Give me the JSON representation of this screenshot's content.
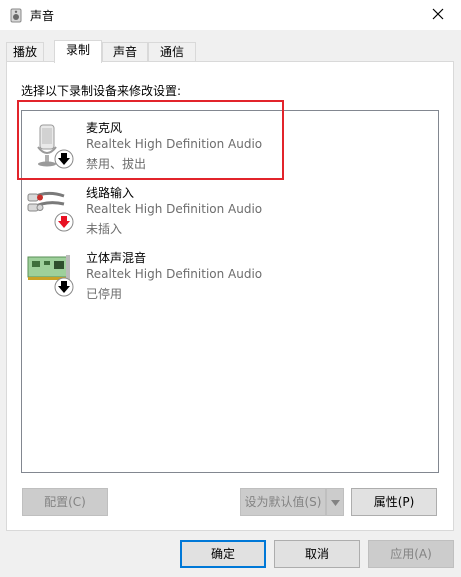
{
  "window": {
    "title": "声音",
    "icon": "speaker-icon",
    "close_icon": "close-icon"
  },
  "tabs": [
    {
      "label": "播放",
      "active": false
    },
    {
      "label": "录制",
      "active": true
    },
    {
      "label": "声音",
      "active": false
    },
    {
      "label": "通信",
      "active": false
    }
  ],
  "instruction": "选择以下录制设备来修改设置:",
  "devices": [
    {
      "name": "麦克风",
      "driver": "Realtek High Definition Audio",
      "status": "禁用、拔出",
      "icon": "microphone-icon",
      "badge": "down-arrow-badge",
      "badge_color": "#000000"
    },
    {
      "name": "线路输入",
      "driver": "Realtek High Definition Audio",
      "status": "未插入",
      "icon": "line-in-cable-icon",
      "badge": "down-arrow-badge",
      "badge_color": "#e81123"
    },
    {
      "name": "立体声混音",
      "driver": "Realtek High Definition Audio",
      "status": "已停用",
      "icon": "sound-card-icon",
      "badge": "down-arrow-badge",
      "badge_color": "#000000"
    }
  ],
  "panel_buttons": {
    "configure": "配置(C)",
    "set_default": "设为默认值(S)",
    "properties": "属性(P)"
  },
  "dialog_buttons": {
    "ok": "确定",
    "cancel": "取消",
    "apply": "应用(A)"
  },
  "colors": {
    "highlight_box": "#e2242b",
    "default_button_border": "#0078d7",
    "disabled_text": "#838383"
  }
}
